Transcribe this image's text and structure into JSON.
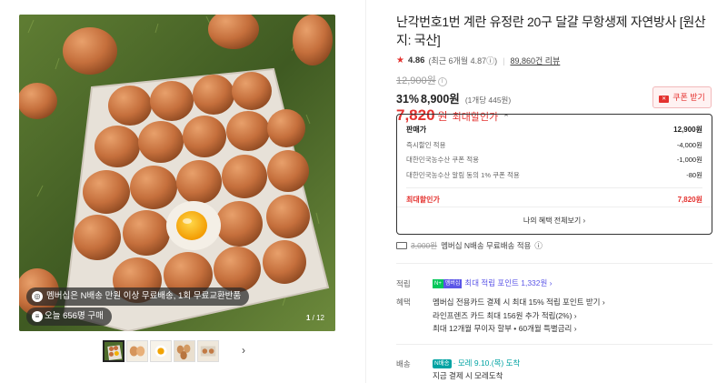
{
  "gallery": {
    "badge_membership": "멤버십은 N배송 만원 이상 무료배송, 1회 무료교환반품",
    "badge_buyers": "오늘 656명 구매",
    "page_current": "1",
    "page_total": "/ 12",
    "prev_arrow": "‹",
    "next_arrow": "›",
    "thumbnail_count": 5
  },
  "product": {
    "title": "난각번호1번 계란 유정란 20구 달걀 무항생제 자연방사 [원산지: 국산]",
    "rating": "4.86",
    "rating_detail": "(최근 6개월 4.87",
    "rating_info_icon": "ⓘ",
    "rating_close": ")",
    "review_link": "89,860건 리뷰",
    "original_price": "12,900원",
    "discount_percent": "31%",
    "sale_price": "8,900원",
    "unit_price": "(1개당 445원)",
    "max_discount_price": "7,820",
    "max_discount_won": "원",
    "max_discount_label": "최대할인가",
    "coupon_button": "쿠폰 받기"
  },
  "price_breakdown": {
    "rows": [
      {
        "label": "판매가",
        "value": "12,900원"
      },
      {
        "label": "즉시할인 적용",
        "value": "-4,000원"
      },
      {
        "label": "대한민국농수산 쿠폰 적용",
        "value": "-1,000원"
      },
      {
        "label": "대한민국농수산 알림 동의 1% 쿠폰 적용",
        "value": "-80원"
      }
    ],
    "max_label": "최대할인가",
    "max_value": "7,820원",
    "benefits_link": "나의 혜택 전체보기 ›"
  },
  "shipping": {
    "original_fee": "3,000원",
    "text": "멤버십 N배송 무료배송 적용",
    "info_icon": "ⓘ"
  },
  "points": {
    "label": "적립",
    "badge_n": "N+",
    "badge_member": "멤버십",
    "text": "최대 적립 포인트 1,332원 ›"
  },
  "benefits": {
    "label": "혜택",
    "lines": [
      "멤버십 전용카드 결제 시 최대 15% 적립 포인트 받기 ›",
      "라인프렌즈 카드 최대 156원 추가 적립(2%) ›",
      "최대 12개월 무이자 할부 • 60개월 특별금리 ›"
    ]
  },
  "delivery": {
    "label": "배송",
    "badge": "N배송",
    "eta": "· 모레 9.10.(목) 도착",
    "note": "지금 결제 시 모레도착"
  },
  "colors": {
    "accent_red": "#e4322f",
    "naver_green": "#03c75a",
    "membership_purple": "#5b56e7",
    "delivery_teal": "#00a3a3"
  }
}
